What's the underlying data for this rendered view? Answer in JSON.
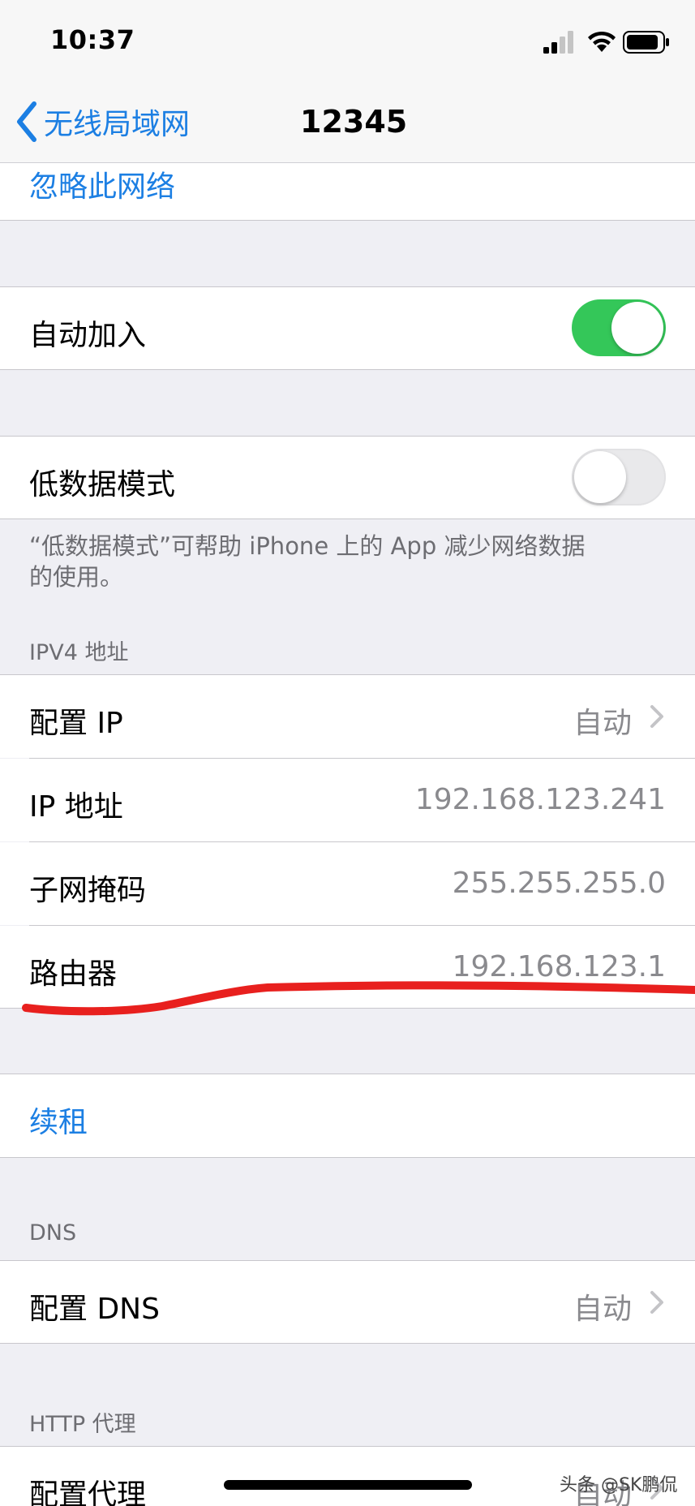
{
  "status_bar": {
    "time": "10:37"
  },
  "nav": {
    "back_label": "无线局域网",
    "title": "12345"
  },
  "forget_network": {
    "label": "忽略此网络"
  },
  "auto_join": {
    "label": "自动加入",
    "enabled": true
  },
  "low_data_mode": {
    "label": "低数据模式",
    "enabled": false,
    "note": "“低数据模式”可帮助 iPhone 上的 App 减少网络数据的使用。"
  },
  "ipv4": {
    "header": "IPV4 地址",
    "rows": [
      {
        "label": "配置 IP",
        "value": "自动"
      },
      {
        "label": "IP 地址",
        "value": "192.168.123.241"
      },
      {
        "label": "子网掩码",
        "value": "255.255.255.0"
      },
      {
        "label": "路由器",
        "value": "192.168.123.1"
      }
    ]
  },
  "renew_lease": {
    "label": "续租"
  },
  "dns": {
    "header": "DNS",
    "configure_label": "配置 DNS",
    "configure_value": "自动"
  },
  "http_proxy": {
    "header": "HTTP 代理",
    "configure_label": "配置代理",
    "configure_value": "自动"
  },
  "watermark": "头条 @SK鹏侃",
  "colors": {
    "accent": "#1c7fe3",
    "toggle_on": "#34c759",
    "annotation": "#e8201e"
  }
}
